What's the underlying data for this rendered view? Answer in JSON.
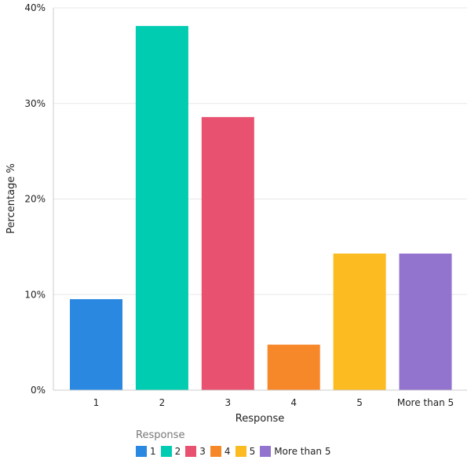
{
  "chart_data": {
    "type": "bar",
    "title": "",
    "xlabel": "Response",
    "ylabel": "Percentage %",
    "categories": [
      "1",
      "2",
      "3",
      "4",
      "5",
      "More than 5"
    ],
    "values": [
      9.52,
      38.1,
      28.57,
      4.76,
      14.29,
      14.29
    ],
    "colors": [
      "#2a88e0",
      "#00ccb1",
      "#e8516f",
      "#f7882a",
      "#fbbb21",
      "#9274cf"
    ],
    "ylim": [
      0,
      40
    ],
    "yticks": [
      0,
      10,
      20,
      30,
      40
    ],
    "ytick_labels": [
      "0%",
      "10%",
      "20%",
      "30%",
      "40%"
    ],
    "grid": true,
    "legend": {
      "title": "Response",
      "placement": "bottom",
      "entries": [
        "1",
        "2",
        "3",
        "4",
        "5",
        "More than 5"
      ]
    }
  }
}
